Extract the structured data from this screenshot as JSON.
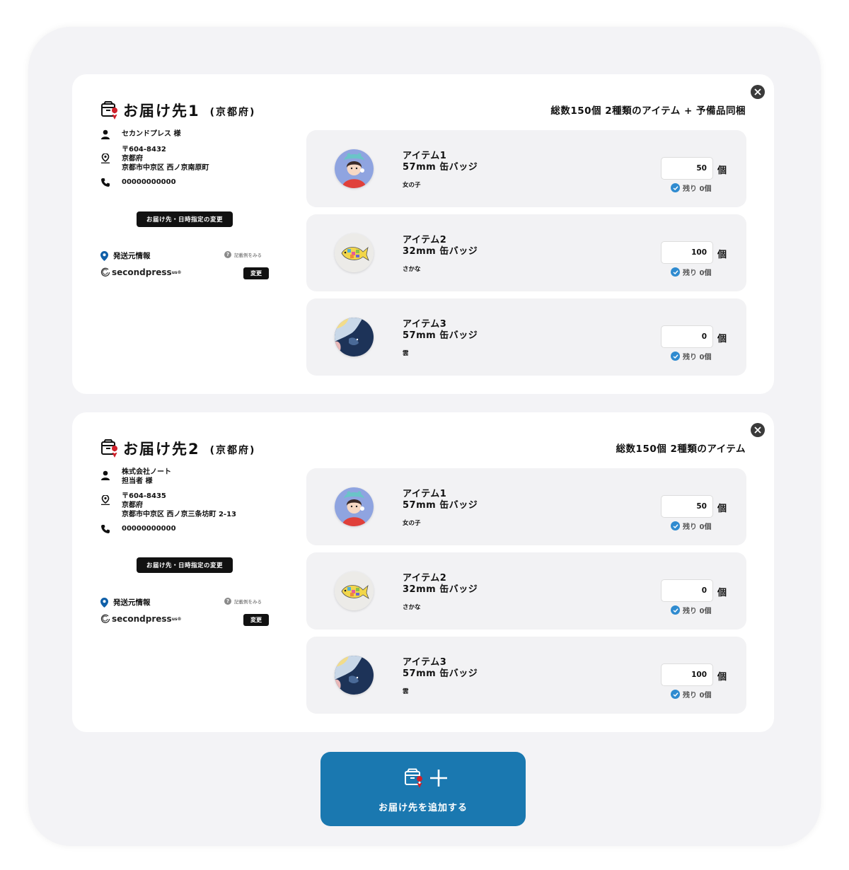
{
  "destinations": [
    {
      "title": "お届け先1",
      "prefecture": "(京都府)",
      "summary": "総数150個 2種類のアイテム + 予備品同梱",
      "name_lines": [
        "セカンドプレス 様"
      ],
      "address_lines": [
        "〒604-8432",
        "京都府",
        "京都市中京区 西ノ京南原町"
      ],
      "phone": "00000000000",
      "change_button": "お届け先・日時指定の変更",
      "origin_label": "発送元情報",
      "help_text": "記載例をみる",
      "origin_logo": "secondpress",
      "origin_logo_sub": "us",
      "origin_logo_sup": "®",
      "origin_change": "変更",
      "items": [
        {
          "name": "アイテム1",
          "spec": "57mm 缶バッジ",
          "sub": "女の子",
          "qty": "50",
          "unit": "個",
          "remain": "残り 0個",
          "badge_icon": "girl-badge"
        },
        {
          "name": "アイテム2",
          "spec": "32mm 缶バッジ",
          "sub": "さかな",
          "qty": "100",
          "unit": "個",
          "remain": "残り 0個",
          "badge_icon": "fish-badge"
        },
        {
          "name": "アイテム3",
          "spec": "57mm 缶バッジ",
          "sub": "雲",
          "qty": "0",
          "unit": "個",
          "remain": "残り 0個",
          "badge_icon": "cloud-badge"
        }
      ]
    },
    {
      "title": "お届け先2",
      "prefecture": "(京都府)",
      "summary": "総数150個 2種類のアイテム",
      "name_lines": [
        "株式会社ノート",
        "担当者 様"
      ],
      "address_lines": [
        "〒604-8435",
        "京都府",
        "京都市中京区 西ノ京三条坊町 2-13"
      ],
      "phone": "00000000000",
      "change_button": "お届け先・日時指定の変更",
      "origin_label": "発送元情報",
      "help_text": "記載例をみる",
      "origin_logo": "secondpress",
      "origin_logo_sub": "us",
      "origin_logo_sup": "®",
      "origin_change": "変更",
      "items": [
        {
          "name": "アイテム1",
          "spec": "57mm 缶バッジ",
          "sub": "女の子",
          "qty": "50",
          "unit": "個",
          "remain": "残り 0個",
          "badge_icon": "girl-badge"
        },
        {
          "name": "アイテム2",
          "spec": "32mm 缶バッジ",
          "sub": "さかな",
          "qty": "0",
          "unit": "個",
          "remain": "残り 0個",
          "badge_icon": "fish-badge"
        },
        {
          "name": "アイテム3",
          "spec": "57mm 缶バッジ",
          "sub": "雲",
          "qty": "100",
          "unit": "個",
          "remain": "残り 0個",
          "badge_icon": "cloud-badge"
        }
      ]
    }
  ],
  "add_button": {
    "label": "お届け先を追加する"
  },
  "colors": {
    "accent": "#1a78b0",
    "check": "#2f8bd0",
    "pin": "#0f5fa8",
    "panel_bg": "#f3f3f6",
    "item_bg": "#f2f2f4"
  }
}
